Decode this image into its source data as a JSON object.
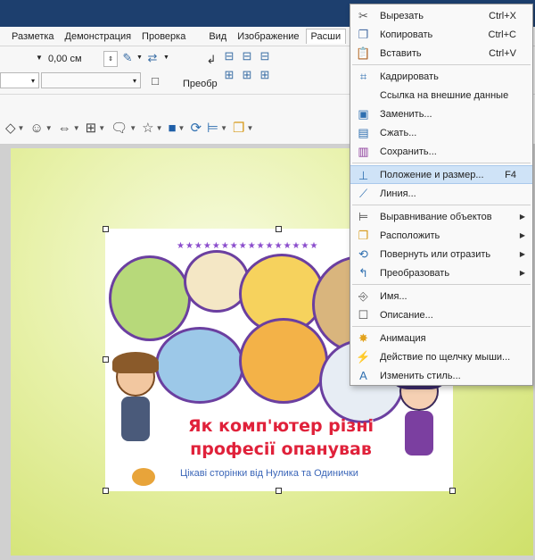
{
  "menubar": {
    "items": [
      "Разметка",
      "Демонстрация",
      "Проверка",
      "Вид",
      "Изображение",
      "Расши"
    ]
  },
  "toolbar": {
    "size_value": "0,00 см",
    "transform_label": "Преобр"
  },
  "picture": {
    "title_line1": "Як комп'ютер різні",
    "title_line2": "професії опанував",
    "subtitle": "Цікаві сторінки від Нулика та Одинички",
    "stars": "★★★★★★★★★★★★★★★★"
  },
  "context_menu": {
    "items": [
      {
        "label": "Вырезать",
        "shortcut": "Ctrl+X",
        "icon": "scissors-icon"
      },
      {
        "label": "Копировать",
        "shortcut": "Ctrl+C",
        "icon": "copy-icon"
      },
      {
        "label": "Вставить",
        "shortcut": "Ctrl+V",
        "icon": "paste-icon"
      },
      {
        "label": "Кадрировать",
        "shortcut": "",
        "icon": "crop-icon"
      },
      {
        "label": "Ссылка на внешние данные",
        "shortcut": "",
        "icon": ""
      },
      {
        "label": "Заменить...",
        "shortcut": "",
        "icon": "replace-image-icon"
      },
      {
        "label": "Сжать...",
        "shortcut": "",
        "icon": "compress-icon"
      },
      {
        "label": "Сохранить...",
        "shortcut": "",
        "icon": "save-icon"
      },
      {
        "label": "Положение и размер...",
        "shortcut": "F4",
        "icon": "position-size-icon"
      },
      {
        "label": "Линия...",
        "shortcut": "",
        "icon": "line-icon"
      },
      {
        "label": "Выравнивание объектов",
        "shortcut": "",
        "icon": "align-icon",
        "submenu": true
      },
      {
        "label": "Расположить",
        "shortcut": "",
        "icon": "arrange-icon",
        "submenu": true
      },
      {
        "label": "Повернуть или отразить",
        "shortcut": "",
        "icon": "rotate-icon",
        "submenu": true
      },
      {
        "label": "Преобразовать",
        "shortcut": "",
        "icon": "convert-icon",
        "submenu": true
      },
      {
        "label": "Имя...",
        "shortcut": "",
        "icon": "name-icon"
      },
      {
        "label": "Описание...",
        "shortcut": "",
        "icon": "description-icon"
      },
      {
        "label": "Анимация",
        "shortcut": "",
        "icon": "animation-icon"
      },
      {
        "label": "Действие по щелчку мыши...",
        "shortcut": "",
        "icon": "interaction-icon"
      },
      {
        "label": "Изменить стиль...",
        "shortcut": "",
        "icon": "edit-style-icon"
      }
    ]
  },
  "colors": {
    "title_bar": "#1d3f6e",
    "highlight": "#cfe3f7",
    "slide_green": "#cfe06a",
    "title_red": "#e0213a"
  }
}
